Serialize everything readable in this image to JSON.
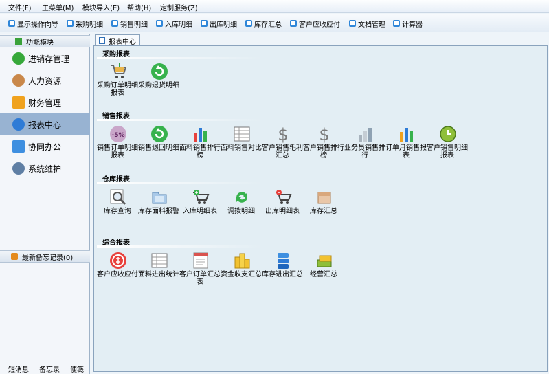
{
  "menu": [
    "文件(F)",
    "主菜单(M)",
    "模块导入(E)",
    "帮助(H)",
    "定制服务(Z)"
  ],
  "toolbar": [
    "显示操作向导",
    "采购明细",
    "销售明细",
    "入库明细",
    "出库明细",
    "库存汇总",
    "客户应收应付",
    "文档管理",
    "计算器"
  ],
  "sidebar": {
    "header": "功能模块",
    "items": [
      "进销存管理",
      "人力资源",
      "财务管理",
      "报表中心",
      "协同办公",
      "系统维护"
    ],
    "memo_header": "最新备忘记录(0)",
    "footer": [
      "短消息",
      "备忘录",
      "便笺"
    ]
  },
  "tab": "报表中心",
  "sections": [
    {
      "title": "采购报表",
      "items": [
        "采购订单明细报表",
        "采购退货明细"
      ]
    },
    {
      "title": "销售报表",
      "items": [
        "销售订单明细报表",
        "销售退回明细",
        "面料销售排行榜",
        "面料销售对比",
        "客户销售毛利汇总",
        "客户销售排行榜",
        "业务员销售排行",
        "订单月销售报表",
        "客户销售明细报表"
      ]
    },
    {
      "title": "仓库报表",
      "items": [
        "库存查询",
        "库存面料报警",
        "入库明细表",
        "调拨明细",
        "出库明细表",
        "库存汇总"
      ]
    },
    {
      "title": "综合报表",
      "items": [
        "客户应收应付",
        "面料进出统计",
        "客户订单汇总表",
        "资金收支汇总",
        "库存进出汇总",
        "经营汇总"
      ]
    }
  ],
  "badge_text": "-5%",
  "colors": {
    "accent": "#2f86d8",
    "active_nav": "#98b3d2",
    "content_bg": "#e3eef4"
  },
  "icons": {
    "sections": [
      [
        "cart-icon",
        "return-icon"
      ],
      [
        "discount-icon",
        "return-icon",
        "bar-chart-icon",
        "table-icon",
        "dollar-icon",
        "dollar-icon",
        "bar-chart-gray-icon",
        "bar-chart-icon",
        "clock-icon"
      ],
      [
        "magnifier-icon",
        "folder-icon",
        "cart-add-icon",
        "refresh-icon",
        "cart-remove-icon",
        "box-icon"
      ],
      [
        "money-icon",
        "table-icon",
        "document-icon",
        "coins-icon",
        "database-icon",
        "money-stack-icon"
      ]
    ]
  }
}
